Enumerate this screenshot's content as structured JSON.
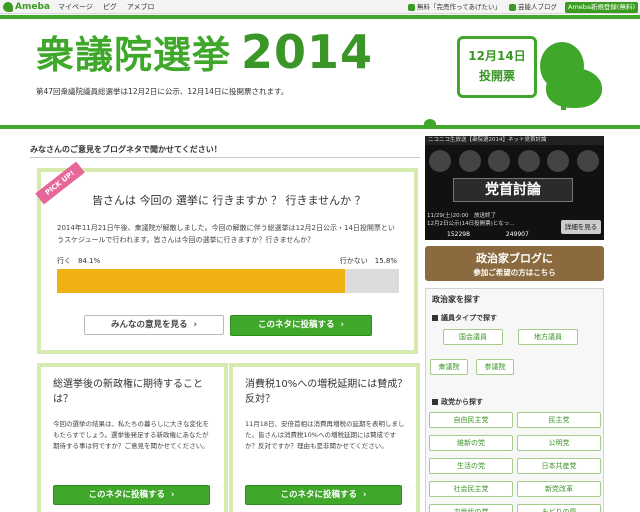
{
  "topbar": {
    "logo": "Ameba",
    "links": [
      "マイページ",
      "ピグ",
      "アメブロ"
    ],
    "right_items": [
      "無料「完売作ってあげたい」",
      "芸能人ブログ",
      "Ameba新規登録(無料)"
    ]
  },
  "header": {
    "title_main": "衆議院選挙",
    "title_year": "2014",
    "subtitle": "第47回衆議院議員総選挙は12月2日に公示、12月14日に投開票されます。",
    "date_line1": "12月14日",
    "date_line2": "投開票"
  },
  "section": {
    "heading": "みなさんのご意見をブログネタで聞かせてください！"
  },
  "pickup": {
    "ribbon": "PICK UP!",
    "question": "皆さんは 今回の 選挙に 行きますか ？ 行きませんか ？",
    "description": "2014年11月21日午後、衆議院が解散しました。今回の解散に伴う総選挙は12月2日公示・14日投開票というスケジュールで行われます。皆さんは今回の選挙に行きますか？行きませんか？",
    "label_yes": "行く　84.1%",
    "label_no": "行かない　15.8%",
    "yes_percent": 84.1,
    "btn_view": "みんなの意見を見る",
    "btn_post": "このネタに投稿する",
    "colors": {
      "bar_fill": "#f0b114",
      "bar_track": "#dcdcdc"
    }
  },
  "cards": [
    {
      "title": "総選挙後の新政権に期待することは？",
      "description": "今回の選挙の結果は、私たちの暮らしに大きな変化をもたらすでしょう。選挙後発足する新政権にあなたが期待する事は何ですか？ご意見を聞かせてください。",
      "btn": "このネタに投稿する"
    },
    {
      "title": "消費税10%への増税延期には賛成？反対？",
      "description": "11月18日、安倍首相は消費再増税の延期を表明しました。皆さんは消費税10%への増税延期には賛成ですか？反対ですか？理由も是非聞かせてください。",
      "btn": "このネタに投稿する"
    }
  ],
  "video": {
    "top_text": "ニコニコ生放送【衆院選2014】ネット党首討論",
    "banner": "党首討論",
    "bottom_line1": "11/29(土)20:00　放送終了",
    "bottom_line2": "12月2日公示(14日投開票)となっ…",
    "count1": "152298",
    "count2": "249907",
    "detail_btn": "詳細を見る"
  },
  "polblog": {
    "line1": "政治家ブログに",
    "line2": "参加ご希望の方はこちら"
  },
  "finder": {
    "title": "政治家を探す",
    "type_heading": "議員タイプで探す",
    "type_buttons": [
      "国会議員",
      "地方議員",
      "衆議院",
      "参議院"
    ],
    "party_heading": "政党から探す",
    "parties": [
      "自由民主党",
      "民主党",
      "維新の党",
      "公明党",
      "生活の党",
      "日本共産党",
      "社会民主党",
      "新党改革",
      "次世代の党",
      "みどりの風"
    ]
  }
}
